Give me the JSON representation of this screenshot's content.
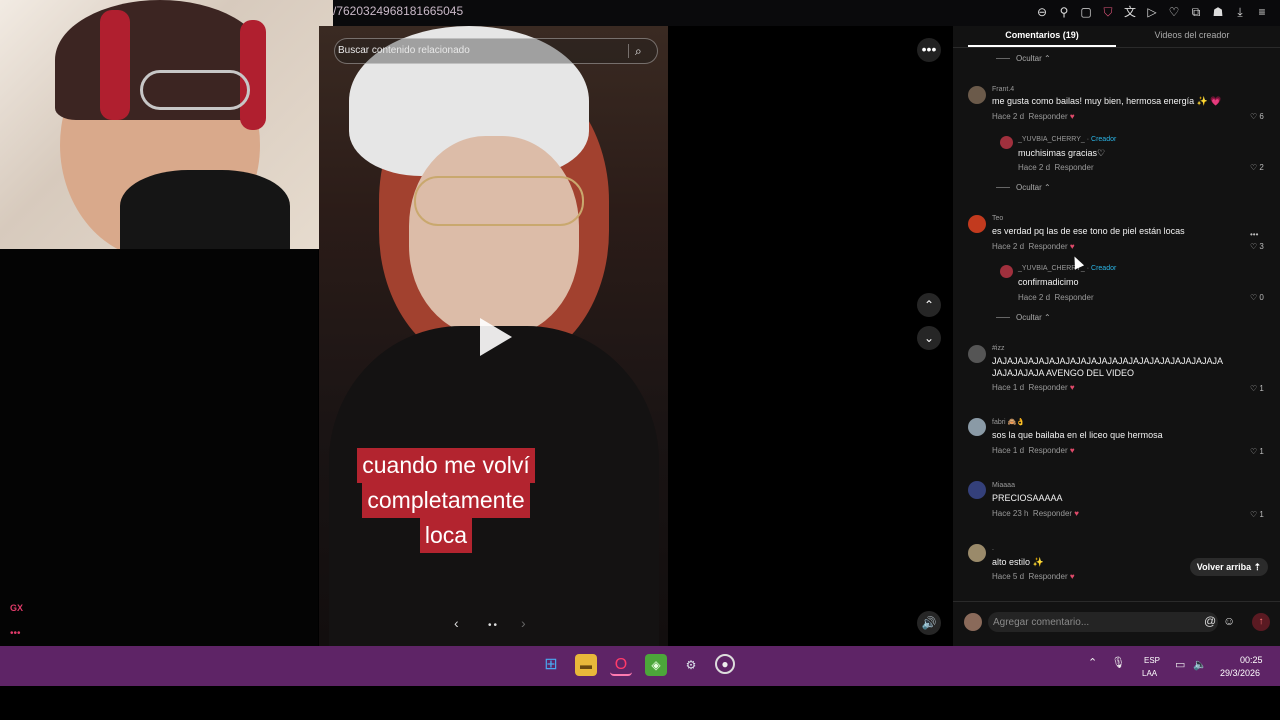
{
  "browser": {
    "url_fragment": "/7620324968181665045",
    "icons": [
      "zoom-icon",
      "pin-icon",
      "screenshot-icon",
      "shield-icon",
      "translate-icon",
      "play-icon",
      "heart-icon",
      "extensions-icon",
      "profile-icon",
      "download-icon",
      "menu-icon"
    ]
  },
  "video": {
    "search_placeholder": "Buscar contenido relacionado",
    "caption_lines": [
      "cuando me volví",
      "completamente",
      "loca"
    ]
  },
  "sidebar": {
    "gx": "GX",
    "dots": "•••"
  },
  "panel": {
    "tabs": {
      "comments": "Comentarios (19)",
      "creator_videos": "Videos del creador"
    },
    "hide_label": "Ocultar",
    "reply_label": "Responder",
    "creator_label": "Creador",
    "back_to_top": "Volver arriba",
    "comment_placeholder": "Agregar comentario...",
    "comments": [
      {
        "user": "Frant.4",
        "text": "me gusta como bailas! muy bien, hermosa energía ✨ 💗",
        "time": "Hace 2 d",
        "likes": "6"
      },
      {
        "user": "_YUVBIA_CHERRY_",
        "text": "muchisimas gracias♡",
        "time": "Hace 2 d",
        "likes": "2",
        "reply": true
      },
      {
        "user": "Teo",
        "text": "es verdad pq las de ese tono de piel están locas",
        "time": "Hace 2 d",
        "likes": "3"
      },
      {
        "user": "_YUVBIA_CHERRY_",
        "text": "confirmadicimo",
        "time": "Hace 2 d",
        "likes": "0",
        "reply": true
      },
      {
        "user": "#izz",
        "text": "JAJAJAJAJAJAJAJAJAJAJAJAJAJAJAJAJAJAJAJAJAJA JAJAJAJAJA AVENGO DEL VIDEO",
        "time": "Hace 1 d",
        "likes": "1"
      },
      {
        "user": "fabri 🙈👌",
        "text": "sos la que bailaba en el liceo que hermosa",
        "time": "Hace 1 d",
        "likes": "1"
      },
      {
        "user": "Miaaaa",
        "text": "PRECIOSAAAAA",
        "time": "Hace 23 h",
        "likes": "1"
      },
      {
        "user": ".",
        "text": "alto estilo ✨",
        "time": "Hace 5 d",
        "likes": ""
      }
    ]
  },
  "taskbar": {
    "lang1": "ESP",
    "lang2": "LAA",
    "time": "00:25",
    "date": "29/3/2026"
  }
}
